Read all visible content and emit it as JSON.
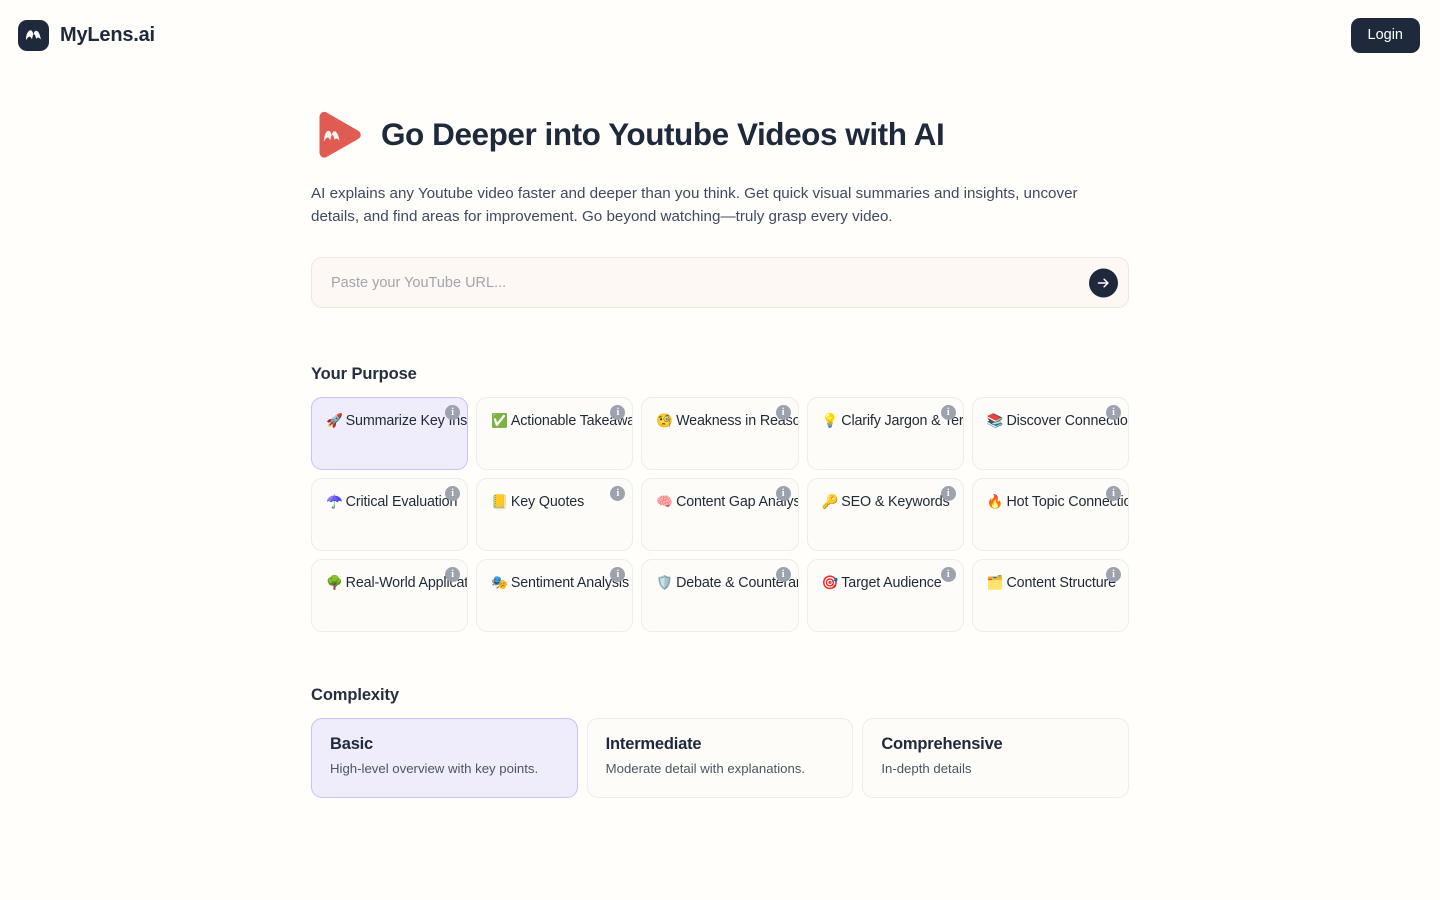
{
  "brand": {
    "name": "MyLens.ai",
    "logo_icon": "mylens-mountain-logo-icon",
    "logo_bg": "#1e293b"
  },
  "header": {
    "login_label": "Login",
    "login_bg": "#1e293b"
  },
  "hero": {
    "icon": "red-play-button-logo-icon",
    "icon_color": "#e05c52",
    "title": "Go Deeper into Youtube Videos with AI",
    "description": "AI explains any Youtube video faster and deeper than you think. Get quick visual summaries and insights, uncover details, and find areas for improvement. Go beyond watching—truly grasp every video."
  },
  "url_form": {
    "placeholder": "Paste your YouTube URL...",
    "value": "",
    "submit_icon": "arrow-right-icon",
    "field_bg": "#fdf8f3"
  },
  "purpose": {
    "title": "Your Purpose",
    "info_glyph": "i",
    "selected_index": 0,
    "selected_bg": "#efecfc",
    "selected_border": "#c9c1f0",
    "items": [
      {
        "emoji": "🚀",
        "icon": "rocket-icon",
        "label": "Summarize Key Insights"
      },
      {
        "emoji": "✅",
        "icon": "check-mark-icon",
        "label": "Actionable Takeaways"
      },
      {
        "emoji": "🧐",
        "icon": "monocle-face-icon",
        "label": "Weakness in Reasoning"
      },
      {
        "emoji": "💡",
        "icon": "light-bulb-icon",
        "label": "Clarify Jargon & Terms"
      },
      {
        "emoji": "📚",
        "icon": "books-icon",
        "label": "Discover Connections"
      },
      {
        "emoji": "☂️",
        "icon": "umbrella-icon",
        "label": "Critical Evaluation"
      },
      {
        "emoji": "📒",
        "icon": "ledger-notebook-icon",
        "label": "Key Quotes"
      },
      {
        "emoji": "🧠",
        "icon": "brain-icon",
        "label": "Content Gap Analysis"
      },
      {
        "emoji": "🔑",
        "icon": "key-icon",
        "label": "SEO & Keywords"
      },
      {
        "emoji": "🔥",
        "icon": "fire-icon",
        "label": "Hot Topic Connections"
      },
      {
        "emoji": "🌳",
        "icon": "tree-icon",
        "label": "Real-World Application"
      },
      {
        "emoji": "🎭",
        "icon": "theater-masks-icon",
        "label": "Sentiment Analysis"
      },
      {
        "emoji": "🛡️",
        "icon": "shield-icon",
        "label": "Debate & Counterargument"
      },
      {
        "emoji": "🎯",
        "icon": "target-icon",
        "label": "Target Audience"
      },
      {
        "emoji": "🗂️",
        "icon": "card-index-dividers-icon",
        "label": "Content Structure"
      }
    ]
  },
  "complexity": {
    "title": "Complexity",
    "selected_index": 0,
    "items": [
      {
        "name": "Basic",
        "desc": "High-level overview with key points."
      },
      {
        "name": "Intermediate",
        "desc": "Moderate detail with explanations."
      },
      {
        "name": "Comprehensive",
        "desc": "In-depth details"
      }
    ]
  }
}
